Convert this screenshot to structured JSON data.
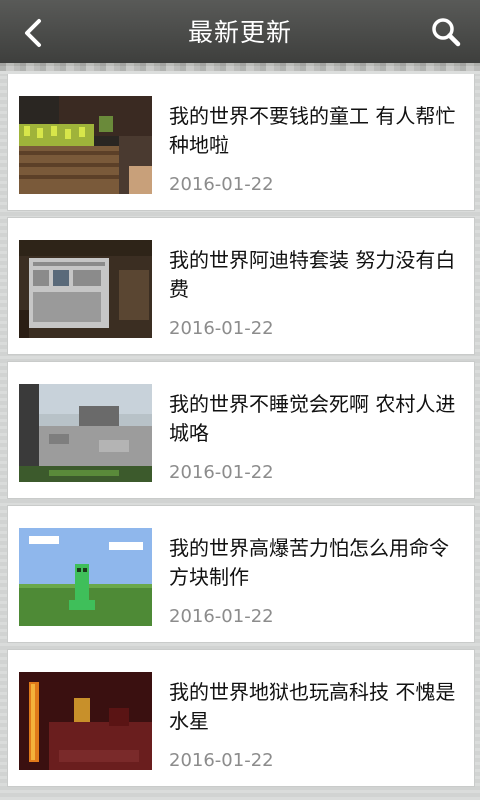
{
  "header": {
    "title": "最新更新",
    "back_icon": "chevron-left-icon",
    "search_icon": "search-icon"
  },
  "items": [
    {
      "title": "我的世界不要钱的童工 有人帮忙种地啦",
      "date": "2016-01-22"
    },
    {
      "title": "我的世界阿迪特套装 努力没有白费",
      "date": "2016-01-22"
    },
    {
      "title": "我的世界不睡觉会死啊 农村人进城咯",
      "date": "2016-01-22"
    },
    {
      "title": "我的世界高爆苦力怕怎么用命令方块制作",
      "date": "2016-01-22"
    },
    {
      "title": "我的世界地狱也玩高科技 不愧是水星",
      "date": "2016-01-22"
    }
  ]
}
